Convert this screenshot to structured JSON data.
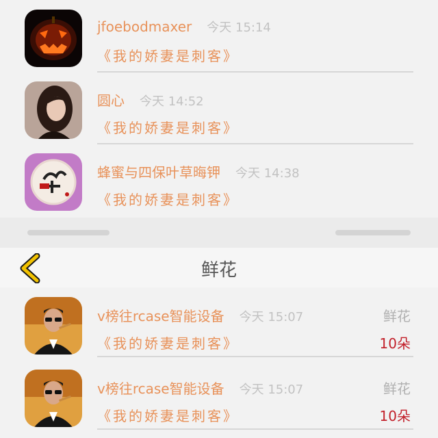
{
  "top_list": [
    {
      "name": "jfoebodmaxer",
      "time": "今天 15:14",
      "book": "《我的娇妻是刺客》",
      "avatar": "pumpkin-avatar"
    },
    {
      "name": "圆心",
      "time": "今天 14:52",
      "book": "《我的娇妻是刺客》",
      "avatar": "woman-portrait-avatar"
    },
    {
      "name": "蜂蜜与四保叶草晦钾",
      "time": "今天 14:38",
      "book": "《我的娇妻是刺客》",
      "avatar": "mid-autumn-avatar"
    }
  ],
  "nav": {
    "title": "鲜花",
    "back_icon": "chevron-left-icon"
  },
  "gift_list": [
    {
      "name": "v榜往rcase智能设备",
      "time": "今天 15:07",
      "book": "《我的娇妻是刺客》",
      "gift_label": "鲜花",
      "gift_count": "10朵",
      "avatar": "man-sunglasses-avatar"
    },
    {
      "name": "v榜往rcase智能设备",
      "time": "今天 15:07",
      "book": "《我的娇妻是刺客》",
      "gift_label": "鲜花",
      "gift_count": "10朵",
      "avatar": "man-sunglasses-avatar"
    }
  ],
  "colors": {
    "accent": "#e8925a",
    "time": "#c2c2c2",
    "count": "#c2202a",
    "back": "#f2c200"
  }
}
